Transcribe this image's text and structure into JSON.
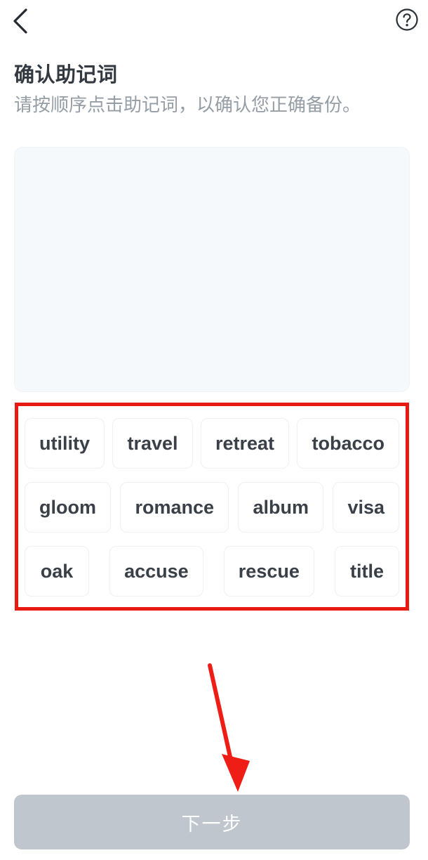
{
  "header": {
    "back_icon": "chevron-left-icon",
    "help_icon": "question-mark-circle-icon",
    "title": "确认助记词",
    "subtitle": "请按顺序点击助记词，以确认您正确备份。"
  },
  "answer_panel": {
    "selected_words": [],
    "background_color": "#f5f9fb"
  },
  "word_bank": {
    "rows": [
      [
        "utility",
        "travel",
        "retreat",
        "tobacco"
      ],
      [
        "gloom",
        "romance",
        "album",
        "visa"
      ],
      [
        "oak",
        "accuse",
        "rescue",
        "title"
      ]
    ]
  },
  "annotations": {
    "color": "#e81b13",
    "rect_target": "word-bank",
    "arrow_target": "next-button"
  },
  "footer": {
    "next_label": "下一步",
    "next_enabled": false,
    "next_color": "#c0c6ce"
  }
}
